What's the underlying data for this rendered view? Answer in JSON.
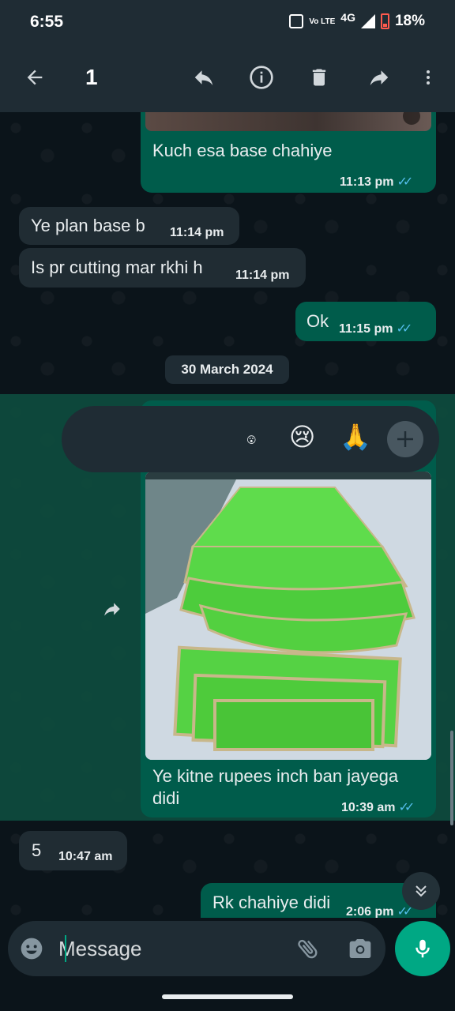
{
  "status_bar": {
    "time": "6:55",
    "network": "4G",
    "volte": "Vo LTE",
    "battery": "18%"
  },
  "app_bar": {
    "selected_count": "1",
    "icons": [
      "back-arrow-icon",
      "reply-icon",
      "info-icon",
      "delete-icon",
      "forward-icon",
      "more-vert-icon"
    ]
  },
  "messages": [
    {
      "direction": "out",
      "text": "Kuch esa base chahiye",
      "time": "11:13 pm",
      "status": "read"
    },
    {
      "direction": "in",
      "text": "Ye plan base b",
      "time": "11:14 pm"
    },
    {
      "direction": "in",
      "text": "Is pr cutting mar rkhi h",
      "time": "11:14 pm"
    },
    {
      "direction": "out",
      "text": "Ok",
      "time": "11:15 pm",
      "status": "read"
    },
    {
      "direction": "out",
      "type": "image",
      "caption": "Ye kitne rupees inch ban jayega didi",
      "time": "10:39 am",
      "status": "read",
      "selected": true
    },
    {
      "direction": "in",
      "text": "5",
      "time": "10:47 am"
    },
    {
      "direction": "out",
      "text": "Rk chahiye didi",
      "time": "2:06 pm",
      "status": "read"
    }
  ],
  "date_separator": "30 March 2024",
  "reactions": [
    "😮",
    "😢",
    "🙏"
  ],
  "composer": {
    "placeholder": "Message"
  },
  "colors": {
    "accent": "#00a884",
    "outgoing_bubble": "#005c4b",
    "incoming_bubble": "#202c33",
    "read_ticks": "#53bdeb",
    "background": "#0b141a"
  }
}
